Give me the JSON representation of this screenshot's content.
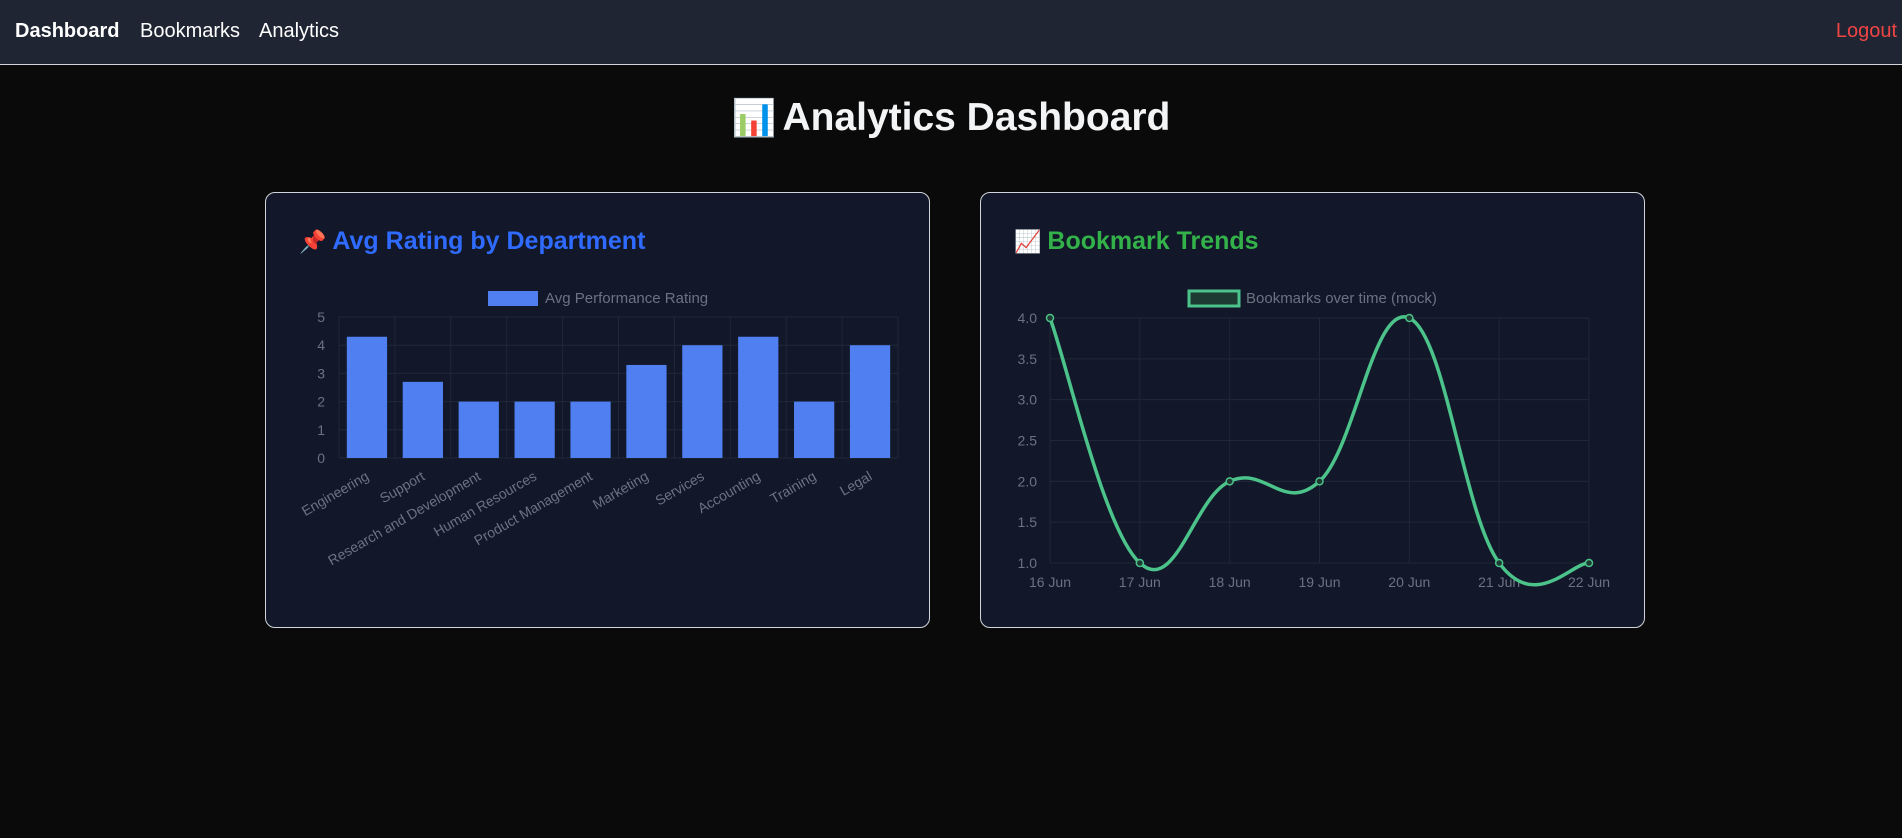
{
  "nav": {
    "dashboard": "Dashboard",
    "bookmarks": "Bookmarks",
    "analytics": "Analytics",
    "logout": "Logout"
  },
  "page": {
    "title_icon": "📊",
    "title": "Analytics Dashboard"
  },
  "cards": {
    "dept": {
      "icon": "📌",
      "title": "Avg Rating by Department"
    },
    "trend": {
      "icon": "📈",
      "title": "Bookmark Trends"
    }
  },
  "colors": {
    "bar": "#4f7ff0",
    "line": "#4cc38a",
    "logout": "#ef4444",
    "dept_title": "#2f6bff",
    "trend_title": "#33b24a"
  },
  "chart_data": [
    {
      "type": "bar",
      "legend": "Avg Performance Rating",
      "categories": [
        "Engineering",
        "Support",
        "Research and Development",
        "Human Resources",
        "Product Management",
        "Marketing",
        "Services",
        "Accounting",
        "Training",
        "Legal"
      ],
      "values": [
        4.3,
        2.7,
        2,
        2,
        2,
        3.3,
        4,
        4.3,
        2,
        4
      ],
      "ylim": [
        0,
        5
      ],
      "yticks": [
        "0",
        "1",
        "2",
        "3",
        "4",
        "5"
      ],
      "legend_position": "top"
    },
    {
      "type": "line",
      "legend": "Bookmarks over time (mock)",
      "categories": [
        "16 Jun",
        "17 Jun",
        "18 Jun",
        "19 Jun",
        "20 Jun",
        "21 Jun",
        "22 Jun"
      ],
      "values": [
        4,
        1,
        2,
        2,
        4,
        1,
        1
      ],
      "ylim": [
        1,
        4
      ],
      "yticks": [
        "1.0",
        "1.5",
        "2.0",
        "2.5",
        "3.0",
        "3.5",
        "4.0"
      ],
      "legend_position": "top"
    }
  ]
}
